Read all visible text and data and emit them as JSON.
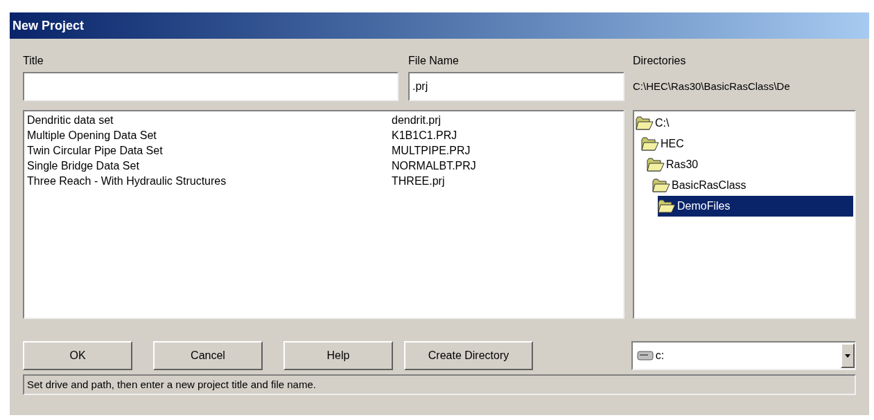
{
  "window": {
    "title": "New Project"
  },
  "title_field": {
    "label": "Title"
  },
  "file_name_field": {
    "label": "File Name",
    "value": ".prj"
  },
  "directories": {
    "label": "Directories",
    "path": "C:\\HEC\\Ras30\\BasicRasClass\\De",
    "tree": [
      {
        "name": "C:\\",
        "selected": false,
        "children": [
          {
            "name": "HEC",
            "selected": false,
            "children": [
              {
                "name": "Ras30",
                "selected": false,
                "children": [
                  {
                    "name": "BasicRasClass",
                    "selected": false,
                    "children": [
                      {
                        "name": "DemoFiles",
                        "selected": true
                      }
                    ]
                  }
                ]
              }
            ]
          }
        ]
      }
    ]
  },
  "projects": [
    {
      "title": "Dendritic data set",
      "file": "dendrit.prj"
    },
    {
      "title": "Multiple Opening Data Set",
      "file": "K1B1C1.PRJ"
    },
    {
      "title": "Twin Circular Pipe Data Set",
      "file": "MULTPIPE.PRJ"
    },
    {
      "title": "Single Bridge Data Set",
      "file": "NORMALBT.PRJ"
    },
    {
      "title": "Three Reach - With Hydraulic Structures",
      "file": "THREE.prj"
    }
  ],
  "buttons": [
    "OK",
    "Cancel",
    "Help",
    "Create Directory"
  ],
  "drive": {
    "value": "c:"
  },
  "status_bar": "Set drive and path, then enter a new project title and file name."
}
